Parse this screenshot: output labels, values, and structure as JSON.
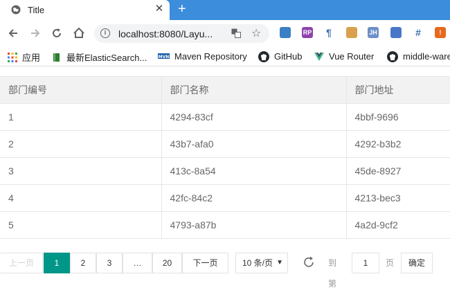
{
  "browser": {
    "tab_title": "Title",
    "tab_close": "✕",
    "new_tab": "+",
    "url": "localhost:8080/Layu...",
    "info_glyph": "i",
    "star_glyph": "☆",
    "extensions": [
      {
        "name": "gear-extension-icon",
        "glyph": "",
        "color": "#3b7fc4"
      },
      {
        "name": "rp-extension-icon",
        "glyph": "RP",
        "color": "#8e44ad"
      },
      {
        "name": "paragraph-extension-icon",
        "glyph": "¶",
        "color": "#ffffff"
      },
      {
        "name": "cookie-extension-icon",
        "glyph": "",
        "color": "#d9a04e"
      },
      {
        "name": "jh-extension-icon",
        "glyph": "JH",
        "color": "#6d8fc9"
      },
      {
        "name": "edit-extension-icon",
        "glyph": "",
        "color": "#4a76c9"
      },
      {
        "name": "grid-extension-icon",
        "glyph": "#",
        "color": "#ffffff"
      },
      {
        "name": "alert-extension-icon",
        "glyph": "!",
        "color": "#e8691c"
      }
    ]
  },
  "bookmarks": [
    {
      "label": "应用",
      "icon": "apps-grid-icon"
    },
    {
      "label": "最新ElasticSearch...",
      "icon": "book-icon"
    },
    {
      "label": "Maven Repository",
      "icon": "mvn-icon"
    },
    {
      "label": "GitHub",
      "icon": "github-icon"
    },
    {
      "label": "Vue Router",
      "icon": "vue-icon"
    },
    {
      "label": "middle-ware",
      "icon": "github-icon"
    }
  ],
  "table": {
    "headers": [
      "部门编号",
      "部门名称",
      "部门地址"
    ],
    "rows": [
      [
        "1",
        "4294-83cf",
        "4bbf-9696"
      ],
      [
        "2",
        "43b7-afa0",
        "4292-b3b2"
      ],
      [
        "3",
        "413c-8a54",
        "45de-8927"
      ],
      [
        "4",
        "42fc-84c2",
        "4213-bec3"
      ],
      [
        "5",
        "4793-a87b",
        "4a2d-9cf2"
      ]
    ]
  },
  "pagination": {
    "prev": "上一页",
    "pages": [
      "1",
      "2",
      "3",
      "…",
      "20"
    ],
    "current_page": "1",
    "next": "下一页",
    "limit": "10 条/页",
    "limit_caret": "▼",
    "goto_label": "到第",
    "goto_value": "1",
    "page_unit": "页",
    "confirm": "确定"
  },
  "colors": {
    "tabstrip": "#3c8ddb",
    "active_page": "#009688"
  }
}
